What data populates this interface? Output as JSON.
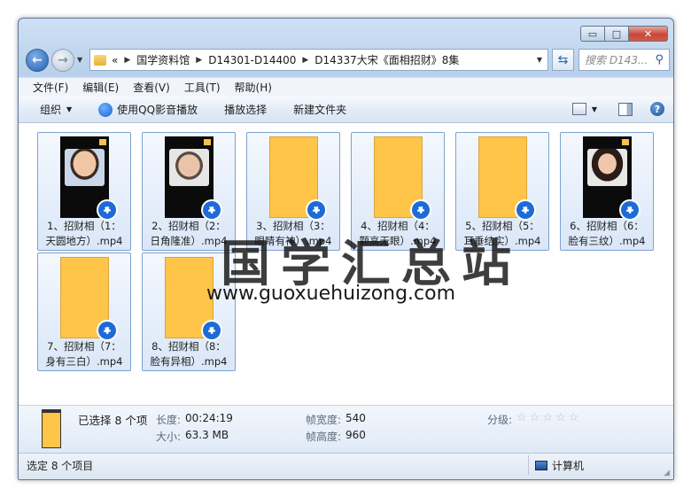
{
  "window": {
    "caption_min": "▭",
    "caption_max": "□",
    "caption_close": "✕"
  },
  "address": {
    "overflow": "«",
    "crumbs": [
      "国学资料馆",
      "D14301-D14400",
      "D14337大宋《面相招财》8集"
    ],
    "search_placeholder": "搜索 D143..."
  },
  "menu": [
    "文件(F)",
    "编辑(E)",
    "查看(V)",
    "工具(T)",
    "帮助(H)"
  ],
  "commands": {
    "organize": "组织",
    "play_qq": "使用QQ影音播放",
    "play_selection": "播放选择",
    "new_folder": "新建文件夹"
  },
  "files": [
    {
      "line1": "1、招财相（1：",
      "line2": "天圆地方）.mp4",
      "thumb": "zuck"
    },
    {
      "line1": "2、招财相（2：",
      "line2": "日角隆准）.mp4",
      "thumb": "musk"
    },
    {
      "line1": "3、招财相（3：",
      "line2": "眼睛有神）.mp4",
      "thumb": "yellow"
    },
    {
      "line1": "4、招财相（4：",
      "line2": "颧高无眼）.mp4",
      "thumb": "yellow"
    },
    {
      "line1": "5、招财相（5：",
      "line2": "耳垂结实）.mp4",
      "thumb": "yellow"
    },
    {
      "line1": "6、招财相（6：",
      "line2": "脸有三纹）.mp4",
      "thumb": "woman"
    },
    {
      "line1": "7、招财相（7：",
      "line2": "身有三白）.mp4",
      "thumb": "yellow"
    },
    {
      "line1": "8、招财相（8：",
      "line2": "脸有异相）.mp4",
      "thumb": "yellow"
    }
  ],
  "watermark": {
    "zh": "国学汇总站",
    "url": "www.guoxuehuizong.com"
  },
  "details": {
    "selected": "已选择 8 个项",
    "length_label": "长度:",
    "length_value": "00:24:19",
    "size_label": "大小:",
    "size_value": "63.3 MB",
    "width_label": "帧宽度:",
    "width_value": "540",
    "height_label": "帧高度:",
    "height_value": "960",
    "rating_label": "分级:",
    "stars": "☆☆☆☆☆"
  },
  "status": {
    "left": "选定 8 个项目",
    "right": "计算机"
  }
}
